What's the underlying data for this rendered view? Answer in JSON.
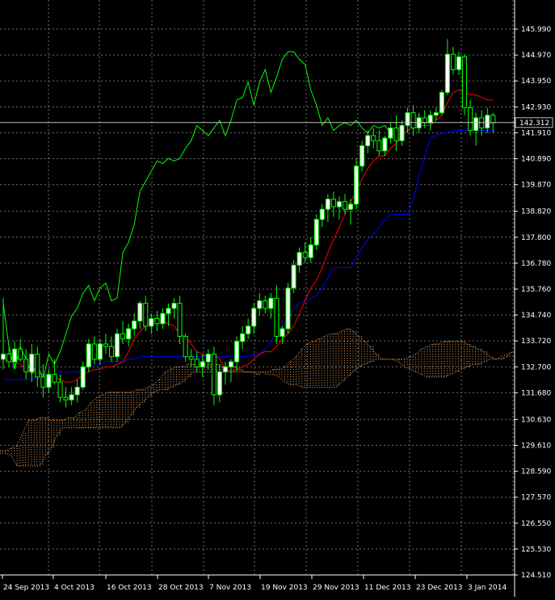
{
  "chart_data": {
    "type": "candlestick",
    "colors": {
      "background": "#000000",
      "grid": "#6f6f6f",
      "axis_text": "#ffffff",
      "bull_candle": "#ffffff",
      "bear_candle": "#000000",
      "wick": "#00ff00",
      "tenkan_sen": "#ff0000",
      "kijun_sen": "#0000ff",
      "chikou_span": "#00ff00",
      "cloud": "#f4a460",
      "current_price_line": "#c0c0c0"
    },
    "ylim": [
      124.51,
      146.5
    ],
    "yticks": [
      "145.990",
      "144.970",
      "143.950",
      "142.930",
      "141.910",
      "140.890",
      "139.870",
      "138.820",
      "137.800",
      "136.780",
      "135.760",
      "134.740",
      "133.720",
      "132.700",
      "131.680",
      "130.630",
      "129.610",
      "128.590",
      "127.570",
      "126.550",
      "125.530",
      "124.510"
    ],
    "xticks": [
      "24 Sep 2013",
      "4 Oct 2013",
      "16 Oct 2013",
      "28 Oct 2013",
      "7 Nov 2013",
      "19 Nov 2013",
      "29 Nov 2013",
      "11 Dec 2013",
      "23 Dec 2013",
      "3 Jan 2014"
    ],
    "current_price_label": "142.312",
    "current_price": 142.312,
    "candles": [
      {
        "o": 133.0,
        "h": 135.4,
        "l": 132.6,
        "c": 133.2
      },
      {
        "o": 133.2,
        "h": 133.6,
        "l": 132.7,
        "c": 132.9
      },
      {
        "o": 132.9,
        "h": 133.7,
        "l": 132.6,
        "c": 133.4
      },
      {
        "o": 133.4,
        "h": 133.8,
        "l": 132.9,
        "c": 133.0
      },
      {
        "o": 133.0,
        "h": 133.4,
        "l": 132.2,
        "c": 132.5
      },
      {
        "o": 132.5,
        "h": 133.6,
        "l": 132.1,
        "c": 133.2
      },
      {
        "o": 133.2,
        "h": 133.5,
        "l": 131.9,
        "c": 132.3
      },
      {
        "o": 132.3,
        "h": 132.8,
        "l": 131.5,
        "c": 131.9
      },
      {
        "o": 131.9,
        "h": 132.6,
        "l": 131.7,
        "c": 132.4
      },
      {
        "o": 132.4,
        "h": 133.0,
        "l": 132.0,
        "c": 132.1
      },
      {
        "o": 132.1,
        "h": 132.4,
        "l": 131.3,
        "c": 131.5
      },
      {
        "o": 131.5,
        "h": 131.9,
        "l": 131.1,
        "c": 131.4
      },
      {
        "o": 131.4,
        "h": 131.9,
        "l": 131.2,
        "c": 131.6
      },
      {
        "o": 131.6,
        "h": 132.2,
        "l": 131.3,
        "c": 131.9
      },
      {
        "o": 131.9,
        "h": 132.9,
        "l": 131.8,
        "c": 132.7
      },
      {
        "o": 132.7,
        "h": 133.8,
        "l": 132.5,
        "c": 133.6
      },
      {
        "o": 133.6,
        "h": 133.9,
        "l": 132.8,
        "c": 133.0
      },
      {
        "o": 133.0,
        "h": 133.8,
        "l": 132.8,
        "c": 133.6
      },
      {
        "o": 133.6,
        "h": 134.0,
        "l": 133.2,
        "c": 133.5
      },
      {
        "o": 133.5,
        "h": 133.9,
        "l": 132.9,
        "c": 133.1
      },
      {
        "o": 133.1,
        "h": 134.2,
        "l": 132.9,
        "c": 134.0
      },
      {
        "o": 134.0,
        "h": 134.5,
        "l": 133.6,
        "c": 133.8
      },
      {
        "o": 133.8,
        "h": 134.4,
        "l": 133.5,
        "c": 134.2
      },
      {
        "o": 134.2,
        "h": 134.8,
        "l": 133.9,
        "c": 134.5
      },
      {
        "o": 134.5,
        "h": 135.3,
        "l": 134.2,
        "c": 135.2
      },
      {
        "o": 135.2,
        "h": 135.5,
        "l": 134.1,
        "c": 134.3
      },
      {
        "o": 134.3,
        "h": 134.8,
        "l": 134.0,
        "c": 134.6
      },
      {
        "o": 134.6,
        "h": 134.9,
        "l": 134.1,
        "c": 134.4
      },
      {
        "o": 134.4,
        "h": 135.0,
        "l": 134.2,
        "c": 134.8
      },
      {
        "o": 134.8,
        "h": 135.2,
        "l": 134.3,
        "c": 135.0
      },
      {
        "o": 135.0,
        "h": 135.4,
        "l": 134.6,
        "c": 135.2
      },
      {
        "o": 135.2,
        "h": 135.5,
        "l": 133.6,
        "c": 133.9
      },
      {
        "o": 133.9,
        "h": 134.0,
        "l": 132.9,
        "c": 133.1
      },
      {
        "o": 133.1,
        "h": 133.4,
        "l": 132.7,
        "c": 133.0
      },
      {
        "o": 133.0,
        "h": 133.3,
        "l": 132.5,
        "c": 132.7
      },
      {
        "o": 132.7,
        "h": 133.2,
        "l": 132.3,
        "c": 132.9
      },
      {
        "o": 132.9,
        "h": 133.4,
        "l": 132.6,
        "c": 133.2
      },
      {
        "o": 133.2,
        "h": 133.5,
        "l": 131.2,
        "c": 131.6
      },
      {
        "o": 131.6,
        "h": 132.8,
        "l": 131.3,
        "c": 132.5
      },
      {
        "o": 132.5,
        "h": 132.9,
        "l": 132.0,
        "c": 132.7
      },
      {
        "o": 132.7,
        "h": 133.0,
        "l": 132.1,
        "c": 132.9
      },
      {
        "o": 132.9,
        "h": 133.9,
        "l": 132.5,
        "c": 133.7
      },
      {
        "o": 133.7,
        "h": 134.3,
        "l": 133.4,
        "c": 134.0
      },
      {
        "o": 134.0,
        "h": 134.6,
        "l": 133.8,
        "c": 134.3
      },
      {
        "o": 134.3,
        "h": 135.2,
        "l": 134.0,
        "c": 135.0
      },
      {
        "o": 135.0,
        "h": 135.6,
        "l": 134.7,
        "c": 135.3
      },
      {
        "o": 135.3,
        "h": 135.5,
        "l": 134.8,
        "c": 135.0
      },
      {
        "o": 135.0,
        "h": 135.6,
        "l": 134.6,
        "c": 135.4
      },
      {
        "o": 135.4,
        "h": 135.9,
        "l": 133.6,
        "c": 133.9
      },
      {
        "o": 133.9,
        "h": 134.3,
        "l": 133.6,
        "c": 134.2
      },
      {
        "o": 134.2,
        "h": 136.0,
        "l": 134.0,
        "c": 135.8
      },
      {
        "o": 135.8,
        "h": 136.9,
        "l": 135.6,
        "c": 136.7
      },
      {
        "o": 136.7,
        "h": 137.4,
        "l": 136.4,
        "c": 137.2
      },
      {
        "o": 137.2,
        "h": 137.6,
        "l": 136.8,
        "c": 137.0
      },
      {
        "o": 137.0,
        "h": 137.8,
        "l": 136.8,
        "c": 137.5
      },
      {
        "o": 137.5,
        "h": 138.7,
        "l": 137.3,
        "c": 138.5
      },
      {
        "o": 138.5,
        "h": 139.1,
        "l": 138.2,
        "c": 138.9
      },
      {
        "o": 138.9,
        "h": 139.5,
        "l": 138.4,
        "c": 139.3
      },
      {
        "o": 139.3,
        "h": 139.6,
        "l": 138.6,
        "c": 139.0
      },
      {
        "o": 139.0,
        "h": 139.4,
        "l": 138.5,
        "c": 139.2
      },
      {
        "o": 139.2,
        "h": 139.5,
        "l": 138.7,
        "c": 138.9
      },
      {
        "o": 138.9,
        "h": 139.3,
        "l": 138.3,
        "c": 139.1
      },
      {
        "o": 139.1,
        "h": 140.9,
        "l": 138.9,
        "c": 140.6
      },
      {
        "o": 140.6,
        "h": 141.6,
        "l": 140.4,
        "c": 141.4
      },
      {
        "o": 141.4,
        "h": 142.0,
        "l": 141.1,
        "c": 141.8
      },
      {
        "o": 141.8,
        "h": 142.1,
        "l": 141.3,
        "c": 141.6
      },
      {
        "o": 141.6,
        "h": 142.0,
        "l": 141.0,
        "c": 141.2
      },
      {
        "o": 141.2,
        "h": 141.8,
        "l": 141.0,
        "c": 141.7
      },
      {
        "o": 141.7,
        "h": 142.3,
        "l": 141.5,
        "c": 142.1
      },
      {
        "o": 142.1,
        "h": 142.6,
        "l": 141.2,
        "c": 141.6
      },
      {
        "o": 141.6,
        "h": 142.4,
        "l": 141.4,
        "c": 142.2
      },
      {
        "o": 142.2,
        "h": 142.9,
        "l": 141.9,
        "c": 142.7
      },
      {
        "o": 142.7,
        "h": 143.0,
        "l": 141.8,
        "c": 142.1
      },
      {
        "o": 142.1,
        "h": 142.7,
        "l": 141.9,
        "c": 142.5
      },
      {
        "o": 142.5,
        "h": 142.8,
        "l": 142.1,
        "c": 142.3
      },
      {
        "o": 142.3,
        "h": 142.8,
        "l": 142.0,
        "c": 142.6
      },
      {
        "o": 142.6,
        "h": 142.9,
        "l": 142.4,
        "c": 142.7
      },
      {
        "o": 142.7,
        "h": 143.6,
        "l": 142.6,
        "c": 143.5
      },
      {
        "o": 143.5,
        "h": 145.6,
        "l": 143.4,
        "c": 145.0
      },
      {
        "o": 145.0,
        "h": 145.3,
        "l": 144.2,
        "c": 144.4
      },
      {
        "o": 144.4,
        "h": 145.1,
        "l": 144.2,
        "c": 144.9
      },
      {
        "o": 144.9,
        "h": 145.0,
        "l": 142.6,
        "c": 142.9
      },
      {
        "o": 142.9,
        "h": 143.2,
        "l": 141.8,
        "c": 142.0
      },
      {
        "o": 142.0,
        "h": 142.7,
        "l": 141.4,
        "c": 142.5
      },
      {
        "o": 142.5,
        "h": 142.8,
        "l": 141.8,
        "c": 142.1
      },
      {
        "o": 142.1,
        "h": 142.9,
        "l": 141.9,
        "c": 142.6
      },
      {
        "o": 142.6,
        "h": 142.7,
        "l": 141.9,
        "c": 142.3
      }
    ],
    "series": [
      {
        "name": "",
        "line": "tenkan_sen",
        "values": [
          133.0,
          132.9,
          132.9,
          132.8,
          132.6,
          132.5,
          132.5,
          132.4,
          132.3,
          132.3,
          132.2,
          132.1,
          132.1,
          132.2,
          132.4,
          132.5,
          132.6,
          132.6,
          132.7,
          132.7,
          132.8,
          132.9,
          133.3,
          133.8,
          134.1,
          134.3,
          134.5,
          134.6,
          134.5,
          134.4,
          134.3,
          134.0,
          133.9,
          133.6,
          133.3,
          133.2,
          133.1,
          133.2,
          133.0,
          132.6,
          132.5,
          132.6,
          132.7,
          132.8,
          133.0,
          133.2,
          133.3,
          133.3,
          133.5,
          133.8,
          134.0,
          134.3,
          134.8,
          135.3,
          135.8,
          136.1,
          136.6,
          137.2,
          137.7,
          138.2,
          138.7,
          139.2,
          139.6,
          140.1,
          140.5,
          140.8,
          141.0,
          141.0,
          141.3,
          141.5,
          141.8,
          142.0,
          142.2,
          142.2,
          142.2,
          142.2,
          142.4,
          142.6,
          143.1,
          143.5,
          143.6,
          143.5,
          143.4,
          143.4,
          143.3,
          143.2,
          143.2
        ]
      },
      {
        "name": "",
        "line": "kijun_sen",
        "values": [
          132.2,
          132.2,
          132.2,
          132.2,
          132.2,
          132.2,
          132.3,
          132.4,
          132.4,
          132.4,
          132.5,
          132.5,
          132.5,
          132.5,
          132.6,
          132.7,
          132.8,
          132.8,
          132.9,
          132.9,
          132.9,
          132.9,
          133.0,
          133.0,
          133.1,
          133.1,
          133.1,
          133.1,
          133.1,
          133.1,
          133.1,
          133.1,
          133.1,
          133.1,
          133.1,
          133.1,
          133.1,
          133.1,
          133.1,
          133.1,
          133.1,
          133.1,
          133.1,
          133.1,
          133.2,
          133.2,
          133.4,
          133.7,
          134.0,
          134.3,
          134.6,
          135.0,
          135.2,
          135.3,
          135.4,
          135.5,
          135.8,
          136.2,
          136.6,
          136.6,
          136.6,
          136.6,
          137.0,
          137.4,
          137.7,
          137.9,
          138.2,
          138.5,
          138.7,
          138.7,
          138.7,
          138.7,
          139.3,
          140.2,
          141.0,
          141.7,
          141.8,
          141.9,
          141.9,
          142.0,
          142.0,
          142.0,
          142.0,
          142.0,
          142.0,
          142.0,
          142.0
        ]
      },
      {
        "name": "",
        "line": "chikou_span",
        "values": [
          135.2,
          133.5,
          132.6,
          133.5,
          133.0,
          132.4,
          132.8,
          132.2,
          133.2,
          132.8,
          133.3,
          134.0,
          134.7,
          135.0,
          135.6,
          135.9,
          135.3,
          135.8,
          136.0,
          135.3,
          135.4,
          137.2,
          137.6,
          138.3,
          139.6,
          140.0,
          140.4,
          140.8,
          140.7,
          140.9,
          140.8,
          140.9,
          141.3,
          141.6,
          142.2,
          142.0,
          141.8,
          142.1,
          142.4,
          141.8,
          142.4,
          143.2,
          143.3,
          143.9,
          143.0,
          143.9,
          144.4,
          143.5,
          144.1,
          144.8,
          145.1,
          145.1,
          144.8,
          144.6,
          143.6,
          143.0,
          142.2,
          142.5,
          142.0,
          142.2,
          142.3,
          142.2,
          142.4,
          142.1,
          141.9,
          142.2,
          142.1,
          142.2,
          141.9
        ]
      },
      {
        "name": "",
        "line": "senkou_span_a",
        "values": [
          129.4,
          129.4,
          129.5,
          129.6,
          130.1,
          130.6,
          130.6,
          130.7,
          130.7,
          130.6,
          130.6,
          130.6,
          130.7,
          130.7,
          130.9,
          131.0,
          131.3,
          131.5,
          131.6,
          131.7,
          131.7,
          131.7,
          131.7,
          131.7,
          131.8,
          131.8,
          131.9,
          132.0,
          132.2,
          132.5,
          132.6,
          132.7,
          132.7,
          132.8,
          132.8,
          132.8,
          132.8,
          132.8,
          132.8,
          132.7,
          132.7,
          132.7,
          132.6,
          132.5,
          132.5,
          132.4,
          132.5,
          132.5,
          132.6,
          132.6,
          132.7,
          132.9,
          133.1,
          133.4,
          133.6,
          133.7,
          133.8,
          133.9,
          134.0,
          134.0,
          134.1,
          134.2,
          134.1,
          133.9,
          133.7,
          133.5,
          133.2,
          133.0,
          133.0,
          133.0,
          133.0,
          133.0,
          133.1,
          133.2,
          133.4,
          133.5,
          133.6,
          133.6,
          133.7,
          133.7,
          133.7,
          133.7,
          133.6,
          133.5,
          133.4,
          133.3,
          133.1,
          133.0,
          133.0,
          133.1,
          133.3,
          133.5,
          133.8,
          134.1,
          134.5,
          134.8,
          135.1,
          135.4,
          135.7,
          135.9,
          136.1,
          136.3,
          136.5,
          136.8,
          137.0,
          137.2,
          137.3,
          137.5
        ]
      },
      {
        "name": "",
        "line": "senkou_span_b",
        "values": [
          129.3,
          129.3,
          129.2,
          128.8,
          128.8,
          128.8,
          128.8,
          128.8,
          129.2,
          129.5,
          130.0,
          130.3,
          130.3,
          130.3,
          130.3,
          130.3,
          130.3,
          130.3,
          130.3,
          130.3,
          130.3,
          130.3,
          130.5,
          130.8,
          131.1,
          131.3,
          131.5,
          131.7,
          131.8,
          131.8,
          131.9,
          132.0,
          132.1,
          132.3,
          132.5,
          132.5,
          132.5,
          132.5,
          132.5,
          132.5,
          132.5,
          132.5,
          132.5,
          132.5,
          132.5,
          132.5,
          132.5,
          132.4,
          132.4,
          132.3,
          132.1,
          132.0,
          132.0,
          131.9,
          131.9,
          131.9,
          131.9,
          131.9,
          131.9,
          131.9,
          132.1,
          132.3,
          132.5,
          132.7,
          132.8,
          132.9,
          133.0,
          133.0,
          133.0,
          133.0,
          132.9,
          132.7,
          132.6,
          132.5,
          132.4,
          132.3,
          132.3,
          132.3,
          132.3,
          132.4,
          132.5,
          132.6,
          132.7,
          132.8,
          132.8,
          132.9,
          133.0,
          133.0,
          133.1,
          133.2,
          133.3,
          133.5,
          133.7,
          133.9,
          134.2,
          134.5,
          134.8,
          135.1,
          135.3,
          135.5,
          135.7,
          135.8,
          135.8,
          135.9,
          136.0,
          136.0,
          136.1,
          136.1
        ]
      }
    ]
  }
}
